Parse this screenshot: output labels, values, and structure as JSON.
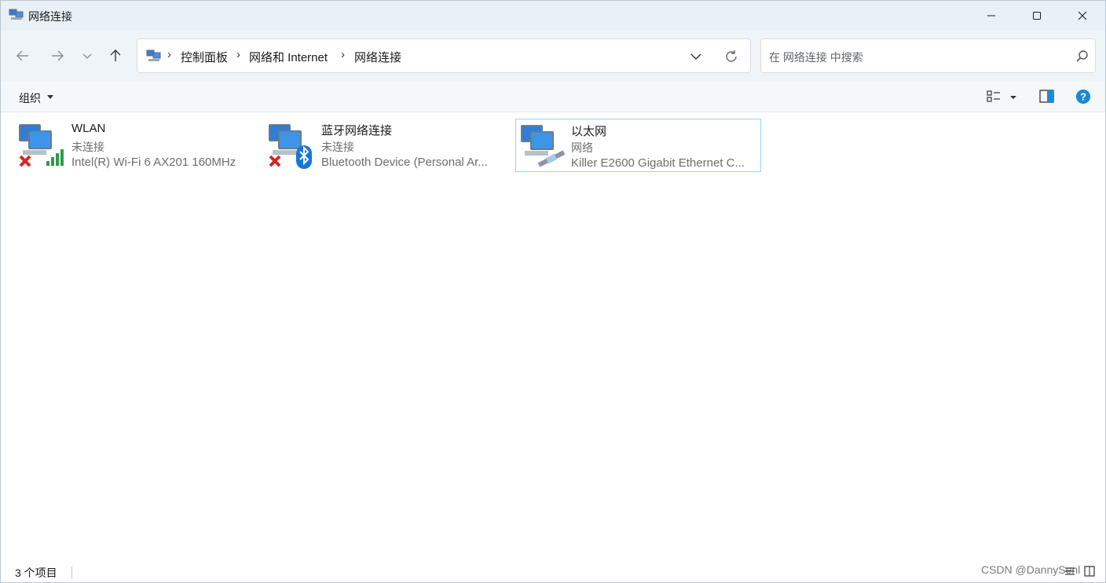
{
  "window": {
    "title": "网络连接"
  },
  "nav": {
    "breadcrumbs": [
      "控制面板",
      "网络和 Internet",
      "网络连接"
    ],
    "search_placeholder": "在 网络连接 中搜索"
  },
  "command_bar": {
    "organize_label": "组织"
  },
  "connections": [
    {
      "name": "WLAN",
      "status": "未连接",
      "device": "Intel(R) Wi-Fi 6 AX201 160MHz",
      "overlay": "wifi-signal-icon",
      "disconnected": true
    },
    {
      "name": "蓝牙网络连接",
      "status": "未连接",
      "device": "Bluetooth Device (Personal Ar...",
      "overlay": "bluetooth-icon",
      "disconnected": true
    },
    {
      "name": "以太网",
      "status": "网络",
      "device": "Killer E2600 Gigabit Ethernet C...",
      "overlay": "ethernet-cable-icon",
      "disconnected": false,
      "selected": true
    }
  ],
  "status_bar": {
    "item_count": "3 个项目",
    "watermark": "CSDN @DannySenl"
  },
  "colors": {
    "accent": "#0067c0",
    "help": "#1a8ad4",
    "selection_border": "#99d1ff",
    "titlebar": "#e9f1f6"
  }
}
